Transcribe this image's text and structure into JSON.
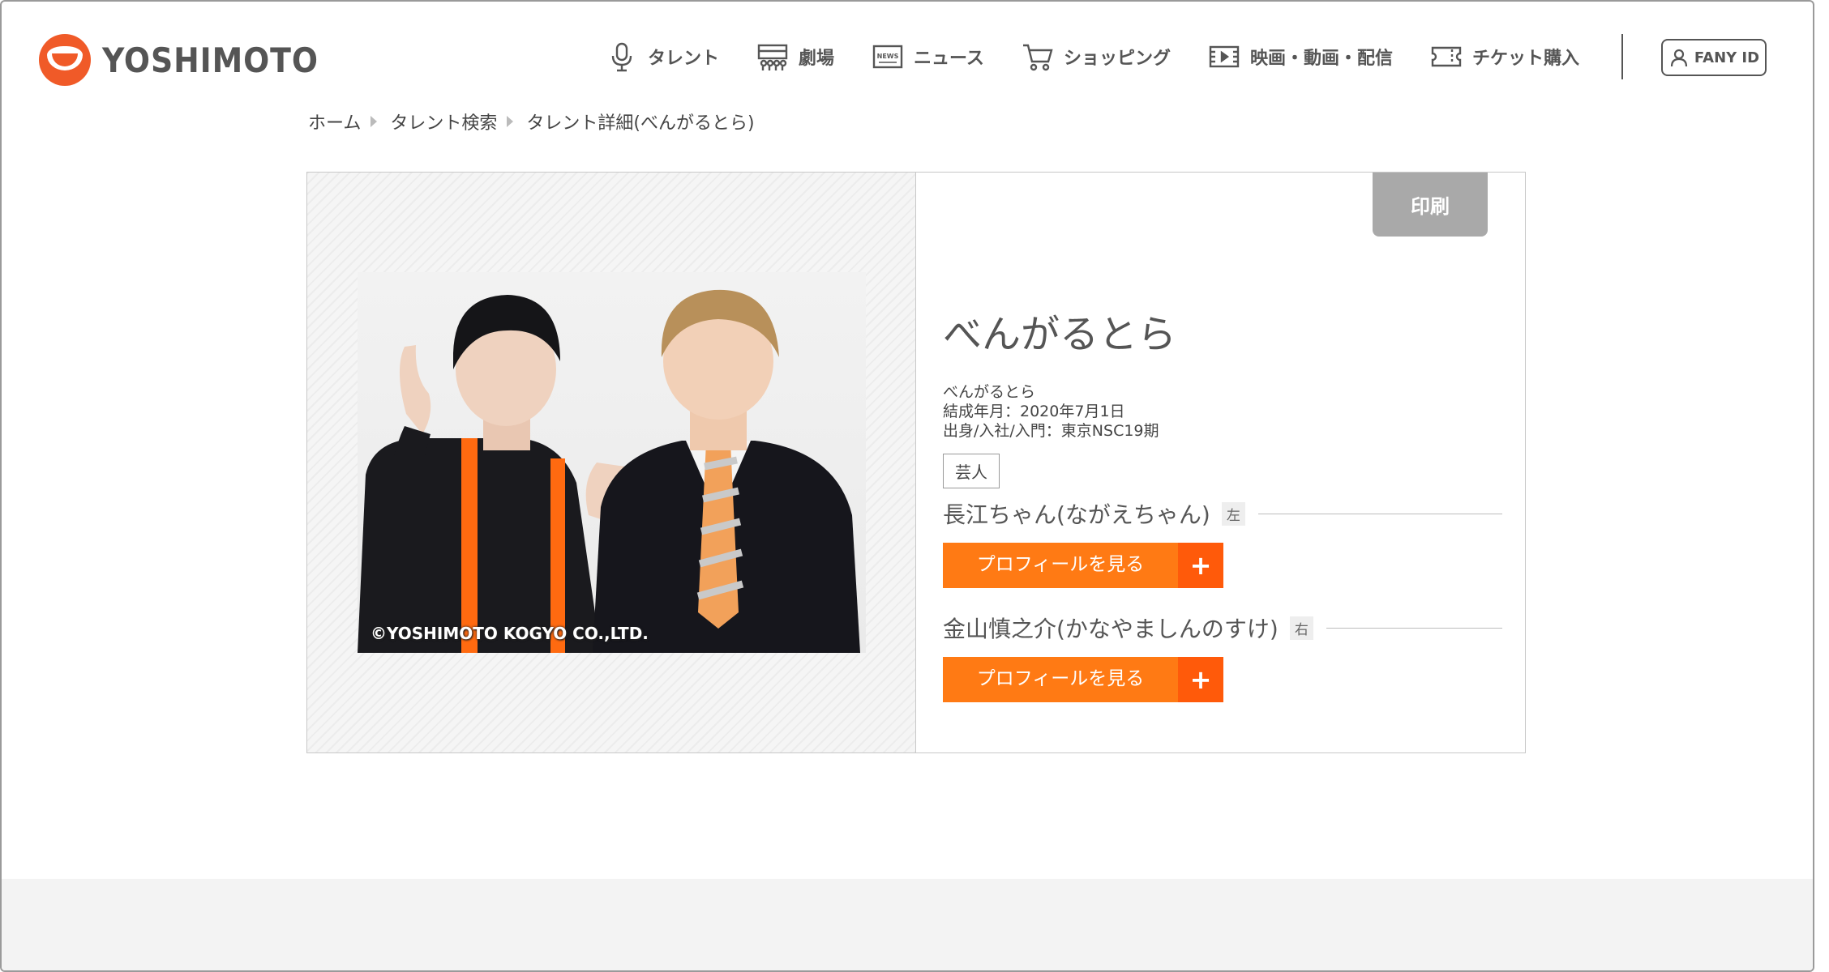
{
  "brand": {
    "name": "YOSHIMOTO",
    "accent": "#f05a28"
  },
  "nav": {
    "items": [
      {
        "label": "タレント",
        "icon": "microphone-icon"
      },
      {
        "label": "劇場",
        "icon": "theater-icon"
      },
      {
        "label": "ニュース",
        "icon": "news-icon"
      },
      {
        "label": "ショッピング",
        "icon": "cart-icon"
      },
      {
        "label": "映画・動画・配信",
        "icon": "film-icon"
      },
      {
        "label": "チケット購入",
        "icon": "ticket-icon"
      }
    ],
    "fany_label": "FANY ID",
    "news_icon_text": "NEWS"
  },
  "breadcrumb": [
    "ホーム",
    "タレント検索",
    "タレント詳細(べんがるとら)"
  ],
  "detail": {
    "print_label": "印刷",
    "title": "べんがるとら",
    "subtitle": "べんがるとら",
    "formed": "結成年月：2020年7月1日",
    "origin": "出身/入社/入門：東京NSC19期",
    "tag": "芸人",
    "photo_credit": "©YOSHIMOTO KOGYO CO.,LTD.",
    "members": [
      {
        "name": "長江ちゃん(ながえちゃん)",
        "position": "左",
        "button": "プロフィールを見る"
      },
      {
        "name": "金山慎之介(かなやましんのすけ)",
        "position": "右",
        "button": "プロフィールを見る"
      }
    ],
    "button_accent": "#ff7a14"
  }
}
